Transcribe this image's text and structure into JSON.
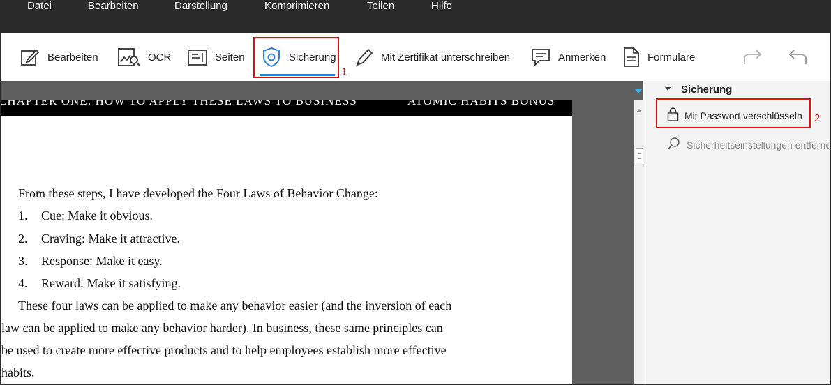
{
  "menu": [
    "Datei",
    "Bearbeiten",
    "Darstellung",
    "Komprimieren",
    "Teilen",
    "Hilfe"
  ],
  "toolbar": {
    "items": [
      {
        "label": "Bearbeiten",
        "icon": "edit-icon"
      },
      {
        "label": "OCR",
        "icon": "ocr-icon"
      },
      {
        "label": "Seiten",
        "icon": "pages-icon"
      },
      {
        "label": "Sicherung",
        "icon": "shield-icon"
      },
      {
        "label": "Mit Zertifikat unterschreiben",
        "icon": "pen-icon"
      },
      {
        "label": "Anmerken",
        "icon": "comment-icon"
      },
      {
        "label": "Formulare",
        "icon": "form-icon"
      }
    ],
    "redo_icon": "redo-icon",
    "undo_icon": "undo-icon",
    "active": "Sicherung"
  },
  "annotations": {
    "marker1": "1",
    "marker2": "2"
  },
  "document": {
    "header_left": "CHAPTER ONE: HOW TO APPLY THESE LAWS TO BUSINESS",
    "header_right": "ATOMIC HABITS BONUS",
    "intro": "From these steps, I have developed the Four Laws of Behavior Change:",
    "list": [
      {
        "num": "1.",
        "text": "Cue: Make it obvious."
      },
      {
        "num": "2.",
        "text": "Craving: Make it attractive."
      },
      {
        "num": "3.",
        "text": "Response: Make it easy."
      },
      {
        "num": "4.",
        "text": "Reward: Make it satisfying."
      }
    ],
    "paragraph": [
      "These four laws can be applied to make any behavior easier (and the inversion of each",
      "law can be applied to make any behavior harder). In business, these same principles can",
      "be used to create more effective products and to help employees establish more effective",
      "habits."
    ]
  },
  "panel": {
    "title": "Sicherung",
    "items": [
      {
        "label": "Mit Passwort verschlüsseln",
        "icon": "lock-icon",
        "enabled": true
      },
      {
        "label": "Sicherheitseinstellungen entfernen",
        "icon": "search-icon",
        "enabled": false
      }
    ]
  },
  "colors": {
    "accent": "#2f82d8",
    "highlight": "#e01010",
    "menubar": "#2b2b2b"
  }
}
